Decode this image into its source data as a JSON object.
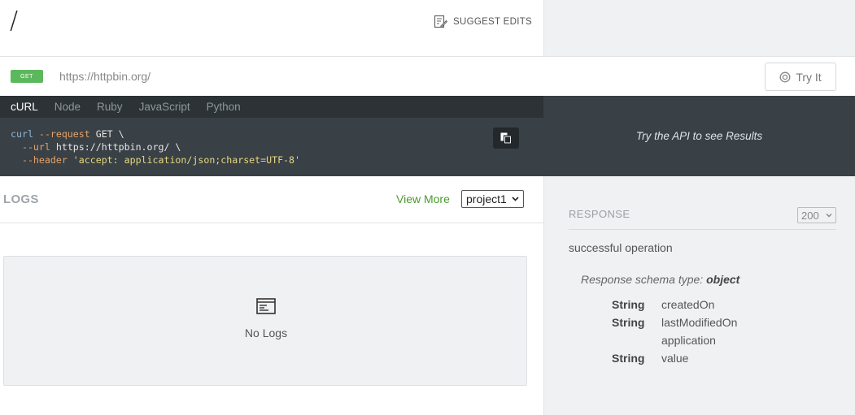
{
  "header": {
    "title": "/",
    "suggest_edits": "SUGGEST EDITS"
  },
  "request": {
    "method": "GET",
    "url": "https://httpbin.org/",
    "try_it_label": "Try It"
  },
  "code": {
    "tabs": [
      "cURL",
      "Node",
      "Ruby",
      "JavaScript",
      "Python"
    ],
    "active_tab": "cURL",
    "line1_cmd": "curl",
    "line1_flag": "--request",
    "line1_rest": " GET \\",
    "line2_flag": "--url",
    "line2_rest": " https://httpbin.org/ \\",
    "line3_flag": "--header",
    "line3_string": "'accept: application/json;charset=UTF-8'"
  },
  "result": {
    "placeholder": "Try the API to see Results"
  },
  "logs": {
    "title": "LOGS",
    "view_more": "View More",
    "project_selected": "project1",
    "empty_text": "No Logs"
  },
  "response": {
    "label": "RESPONSE",
    "status_selected": "200",
    "description": "successful operation",
    "schema_prefix": "Response schema type:",
    "schema_type": "object",
    "fields": [
      {
        "type": "String",
        "name": "createdOn"
      },
      {
        "type": "String",
        "name": "lastModifiedOn"
      },
      {
        "type": "",
        "name": "application"
      },
      {
        "type": "String",
        "name": "value"
      }
    ]
  },
  "colors": {
    "method_get": "#5cb85c",
    "link_green": "#4a9b2e",
    "code_bg": "#394046",
    "tabs_bg": "#2c3236"
  }
}
